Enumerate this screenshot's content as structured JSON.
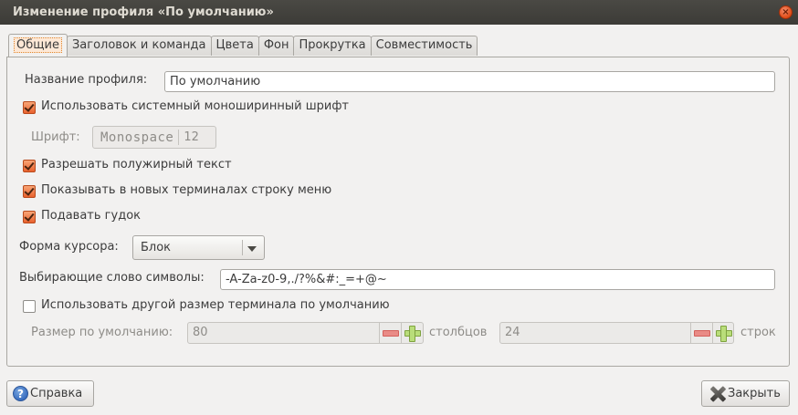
{
  "window": {
    "title": "Изменение профиля «По умолчанию»",
    "close_icon": "close-icon"
  },
  "tabs": [
    {
      "label": "Общие",
      "active": true
    },
    {
      "label": "Заголовок и команда",
      "active": false
    },
    {
      "label": "Цвета",
      "active": false
    },
    {
      "label": "Фон",
      "active": false
    },
    {
      "label": "Прокрутка",
      "active": false
    },
    {
      "label": "Совместимость",
      "active": false
    }
  ],
  "general": {
    "profile_name_label": "Название профиля:",
    "profile_name_value": "По умолчанию",
    "use_system_font_label": "Использовать системный моноширинный шрифт",
    "use_system_font_checked": true,
    "font_label": "Шрифт:",
    "font_name": "Monospace",
    "font_size": "12",
    "allow_bold_label": "Разрешать полужирный текст",
    "allow_bold_checked": true,
    "show_menubar_label": "Показывать в новых терминалах строку меню",
    "show_menubar_checked": true,
    "bell_label": "Подавать гудок",
    "bell_checked": true,
    "cursor_shape_label": "Форма курсора:",
    "cursor_shape_value": "Блок",
    "word_chars_label": "Выбирающие слово символы:",
    "word_chars_value": "-A-Za-z0-9,./?%&#:_=+@~",
    "custom_size_label": "Использовать другой размер терминала по умолчанию",
    "custom_size_checked": false,
    "default_size_label": "Размер по умолчанию:",
    "columns_value": "80",
    "columns_label": "столбцов",
    "rows_value": "24",
    "rows_label": "строк"
  },
  "buttons": {
    "help_label": "Справка",
    "help_icon": "help-icon",
    "close_label": "Закрыть",
    "close_icon": "close-x-icon"
  },
  "colors": {
    "titlebar": "#3c3b37",
    "accent": "#e9622e",
    "window_bg": "#f2f1f0"
  }
}
